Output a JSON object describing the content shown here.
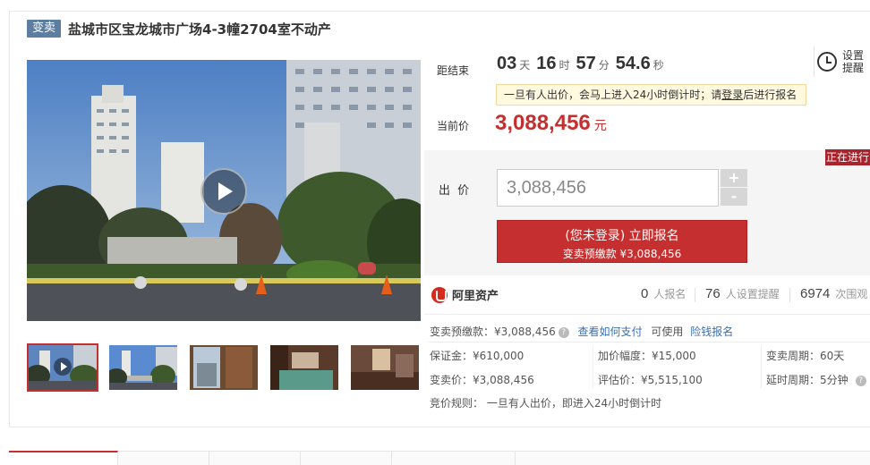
{
  "header": {
    "badge": "变卖",
    "title": "盐城市区宝龙城市广场4-3幢2704室不动产"
  },
  "countdown": {
    "label": "距结束",
    "days": "03",
    "days_unit": "天",
    "hours": "16",
    "hours_unit": "时",
    "minutes": "57",
    "minutes_unit": "分",
    "seconds": "54.6",
    "seconds_unit": "秒"
  },
  "reminder": {
    "label": "设置提醒",
    "icon": "alarm-clock-icon"
  },
  "notice": {
    "text_before": "一旦有人出价，会马上进入24小时倒计时；请",
    "login_link": "登录",
    "text_after": "后进行报名"
  },
  "current_price": {
    "label": "当前价",
    "value": "3,088,456",
    "unit": "元"
  },
  "bid": {
    "status_tag": "正在进行",
    "label": "出  价",
    "input_value": "3,088,456",
    "plus": "+",
    "minus": "-",
    "register_line1": "(您未登录) 立即报名",
    "register_line2": "变卖预缴款 ¥3,088,456"
  },
  "stats": {
    "brand": "阿里资产",
    "registered_count": "0",
    "registered_label": "人报名",
    "reminder_count": "76",
    "reminder_label": "人设置提醒",
    "view_count": "6974",
    "view_label": "次围观"
  },
  "deposit": {
    "label": "变卖预缴款：¥3,088,456",
    "how_to_pay": "查看如何支付",
    "can_use": "可使用",
    "insurance": "险钱报名"
  },
  "details": {
    "margin": "保证金：¥610,000",
    "increment": "加价幅度：¥15,000",
    "sale_period": "变卖周期：60天",
    "sale_price": "变卖价：¥3,088,456",
    "appraisal": "评估价：¥5,515,100",
    "extension": "延时周期：5分钟",
    "rules": "竞价规则：  一旦有人出价，即进入24小时倒计时"
  },
  "colors": {
    "accent": "#c62f2f",
    "badge": "#5d7ea0",
    "link": "#3a6fb0"
  }
}
